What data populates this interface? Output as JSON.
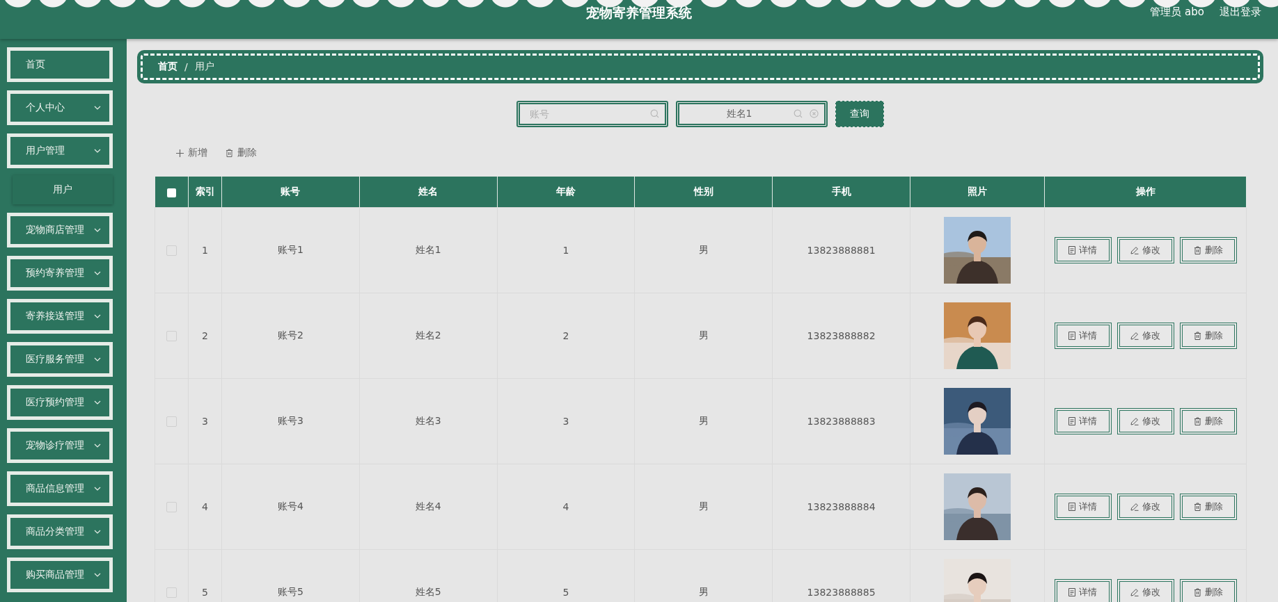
{
  "header": {
    "title": "宠物寄养管理系统",
    "user": "管理员 abo",
    "logout": "退出登录"
  },
  "sidebar": {
    "items": [
      {
        "label": "首页",
        "kind": "link"
      },
      {
        "label": "个人中心",
        "kind": "menu"
      },
      {
        "label": "用户管理",
        "kind": "menu",
        "children": [
          {
            "label": "用户",
            "selected": true
          }
        ]
      },
      {
        "label": "宠物商店管理",
        "kind": "menu"
      },
      {
        "label": "预约寄养管理",
        "kind": "menu"
      },
      {
        "label": "寄养接送管理",
        "kind": "menu"
      },
      {
        "label": "医疗服务管理",
        "kind": "menu"
      },
      {
        "label": "医疗预约管理",
        "kind": "menu"
      },
      {
        "label": "宠物诊疗管理",
        "kind": "menu"
      },
      {
        "label": "商品信息管理",
        "kind": "menu"
      },
      {
        "label": "商品分类管理",
        "kind": "menu"
      },
      {
        "label": "购买商品管理",
        "kind": "menu"
      }
    ]
  },
  "breadcrumb": {
    "items": [
      "首页",
      "用户"
    ],
    "separator": "/"
  },
  "search": {
    "fields": [
      {
        "placeholder": "账号"
      },
      {
        "value": "姓名1"
      }
    ],
    "button": "查询"
  },
  "toolbar": [
    {
      "kind": "add",
      "label": "新增"
    },
    {
      "kind": "delete",
      "label": "删除"
    }
  ],
  "table": {
    "select_all": false,
    "columns": [
      "索引",
      "账号",
      "姓名",
      "年龄",
      "性别",
      "手机",
      "照片",
      "操作"
    ],
    "rows": [
      {
        "checked": false,
        "cells": [
          "1",
          "账号1",
          "姓名1",
          "1",
          "男",
          "13823888881"
        ],
        "actions": [
          {
            "kind": "detail",
            "label": "详情"
          },
          {
            "kind": "edit",
            "label": "修改"
          },
          {
            "kind": "delete",
            "label": "删除"
          }
        ]
      },
      {
        "checked": false,
        "cells": [
          "2",
          "账号2",
          "姓名2",
          "2",
          "男",
          "13823888882"
        ],
        "actions": [
          {
            "kind": "detail",
            "label": "详情"
          },
          {
            "kind": "edit",
            "label": "修改"
          },
          {
            "kind": "delete",
            "label": "删除"
          }
        ]
      },
      {
        "checked": false,
        "cells": [
          "3",
          "账号3",
          "姓名3",
          "3",
          "男",
          "13823888883"
        ],
        "actions": [
          {
            "kind": "detail",
            "label": "详情"
          },
          {
            "kind": "edit",
            "label": "修改"
          },
          {
            "kind": "delete",
            "label": "删除"
          }
        ]
      },
      {
        "checked": false,
        "cells": [
          "4",
          "账号4",
          "姓名4",
          "4",
          "男",
          "13823888884"
        ],
        "actions": [
          {
            "kind": "detail",
            "label": "详情"
          },
          {
            "kind": "edit",
            "label": "修改"
          },
          {
            "kind": "delete",
            "label": "删除"
          }
        ]
      },
      {
        "checked": false,
        "cells": [
          "5",
          "账号5",
          "姓名5",
          "5",
          "男",
          "13823888885"
        ],
        "actions": [
          {
            "kind": "detail",
            "label": "详情"
          },
          {
            "kind": "edit",
            "label": "修改"
          },
          {
            "kind": "delete",
            "label": "删除"
          }
        ]
      }
    ]
  }
}
